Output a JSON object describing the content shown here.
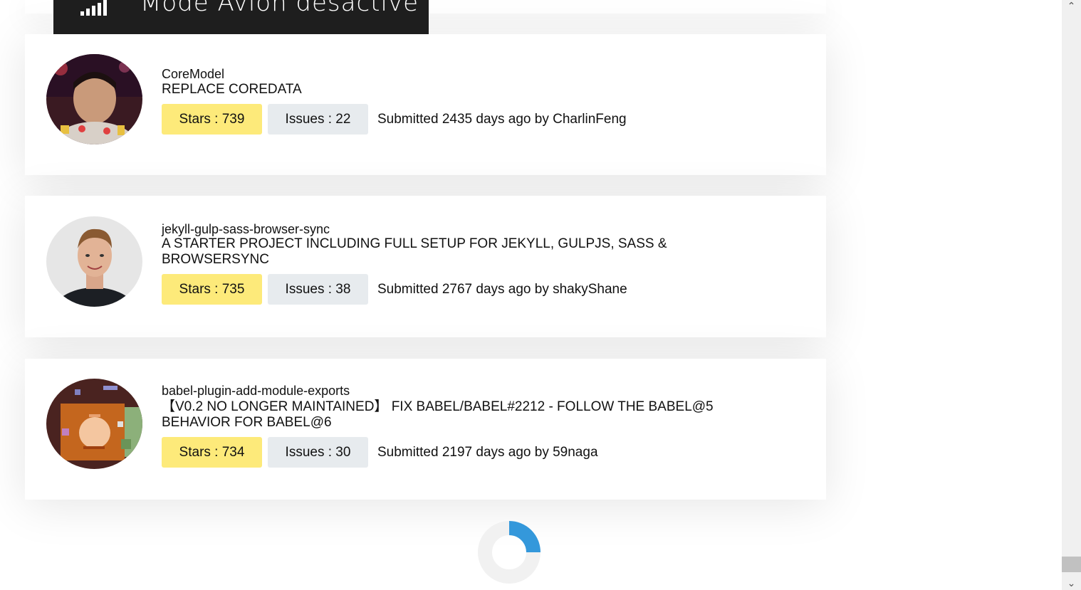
{
  "toast": {
    "text": "Mode Avion désactivé",
    "icon": "signal-bars-icon"
  },
  "repos": [
    {
      "name": "CoreModel",
      "description": "REPLACE COREDATA",
      "stars_label": "Stars : 739",
      "issues_label": "Issues : 22",
      "submitted": "Submitted 2435 days ago by CharlinFeng",
      "avatar": "user-avatar-photo"
    },
    {
      "name": "jekyll-gulp-sass-browser-sync",
      "description": "A STARTER PROJECT INCLUDING FULL SETUP FOR JEKYLL, GULPJS, SASS & BROWSERSYNC",
      "stars_label": "Stars : 735",
      "issues_label": "Issues : 38",
      "submitted": "Submitted 2767 days ago by shakyShane",
      "avatar": "user-avatar-photo"
    },
    {
      "name": "babel-plugin-add-module-exports",
      "description": "【V0.2 NO LONGER MAINTAINED】 FIX BABEL/BABEL#2212 - FOLLOW THE BABEL@5 BEHAVIOR FOR BABEL@6",
      "stars_label": "Stars : 734",
      "issues_label": "Issues : 30",
      "submitted": "Submitted 2197 days ago by 59naga",
      "avatar": "user-avatar-pixel-art"
    }
  ],
  "colors": {
    "stars_badge": "#fdea7a",
    "issues_badge": "#e7ebee",
    "spinner_accent": "#3498db",
    "toast_bg": "#1e1e1e"
  },
  "loading": {
    "spinner_progress": 0.25
  }
}
